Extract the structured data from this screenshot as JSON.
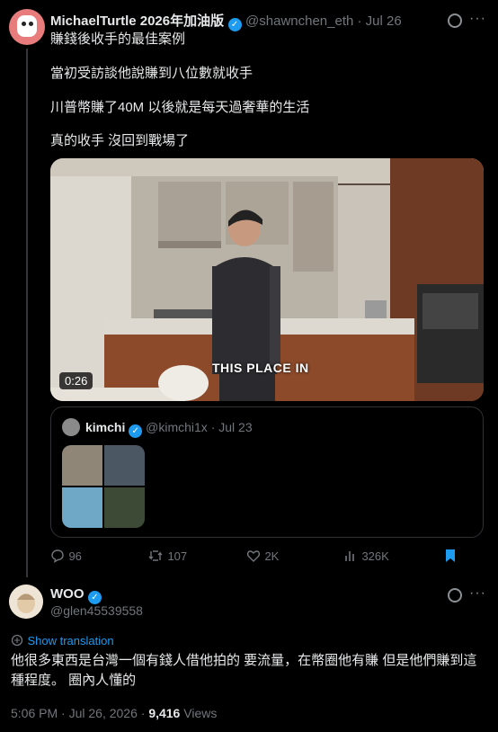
{
  "tweet": {
    "author_name": "MichaelTurtle 2026年加油版",
    "handle_date": "@shawnchen_eth · Jul 26",
    "lines": [
      "賺錢後收手的最佳案例",
      "當初受訪談他說賺到八位數就收手",
      "川普幣賺了40M 以後就是每天過奢華的生活",
      "真的收手 沒回到戰場了"
    ],
    "more_label": "···",
    "video": {
      "duration": "0:26",
      "caption": "THIS PLACE IN"
    },
    "quote": {
      "author_name": "kimchi",
      "handle_date": "@kimchi1x · Jul 23"
    },
    "actions": {
      "replies": "96",
      "retweets": "107",
      "likes": "2K",
      "views": "326K"
    }
  },
  "reply": {
    "author_name": "WOO",
    "handle": "@glen45539558",
    "show_translation": "Show translation",
    "text": "他很多東西是台灣一個有錢人借他拍的 要流量，在幣圈他有賺 但是他們賺到這種程度。 圈內人懂的",
    "timestamp": "5:06 PM · Jul 26, 2026 · ",
    "views_count": "9,416",
    "views_label": " Views"
  },
  "colors": {
    "accent": "#1d9bf0",
    "muted": "#71767b",
    "bg": "#000000"
  },
  "icons": [
    "reply-icon",
    "retweet-icon",
    "like-icon",
    "views-icon",
    "bookmark-icon",
    "grok-icon",
    "verified-icon",
    "translate-icon"
  ]
}
